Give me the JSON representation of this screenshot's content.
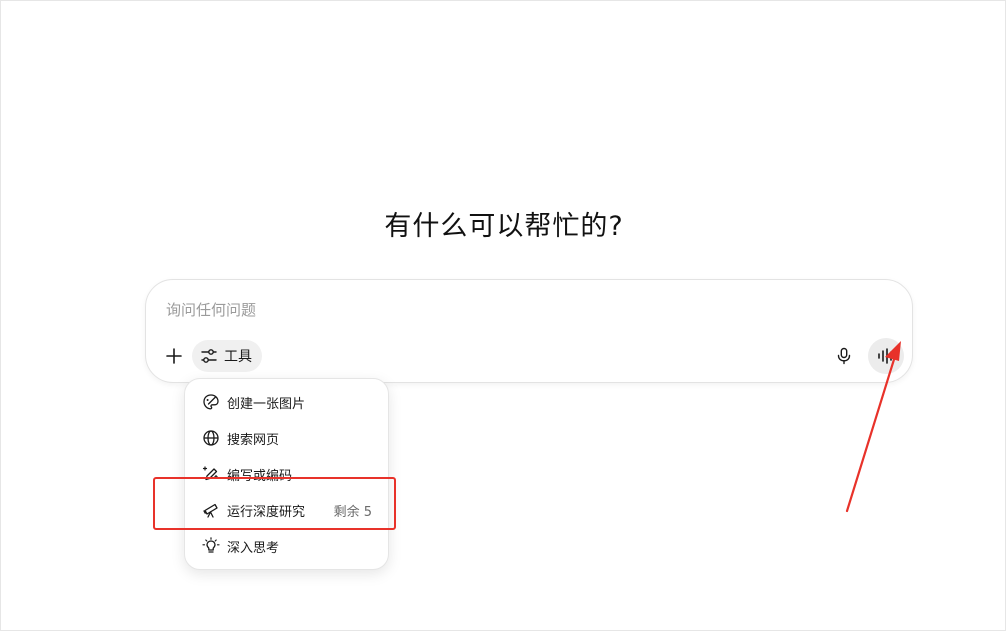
{
  "headline": "有什么可以帮忙的?",
  "composer": {
    "placeholder": "询问任何问题",
    "value": "",
    "tools_label": "工具"
  },
  "icons": {
    "plus": "plus-icon",
    "tools": "sliders-icon",
    "mic": "microphone-icon",
    "voice": "voice-waveform-icon"
  },
  "menu": {
    "items": [
      {
        "label": "创建一张图片",
        "icon": "paint-palette-icon"
      },
      {
        "label": "搜索网页",
        "icon": "globe-icon"
      },
      {
        "label": "编写或编码",
        "icon": "pencil-sparkle-icon"
      },
      {
        "label": "运行深度研究",
        "icon": "telescope-icon",
        "badge": "剩余 5"
      },
      {
        "label": "深入思考",
        "icon": "lightbulb-icon"
      }
    ]
  },
  "annotation_colors": {
    "highlight": "#e8322a",
    "arrow": "#e8322a"
  }
}
